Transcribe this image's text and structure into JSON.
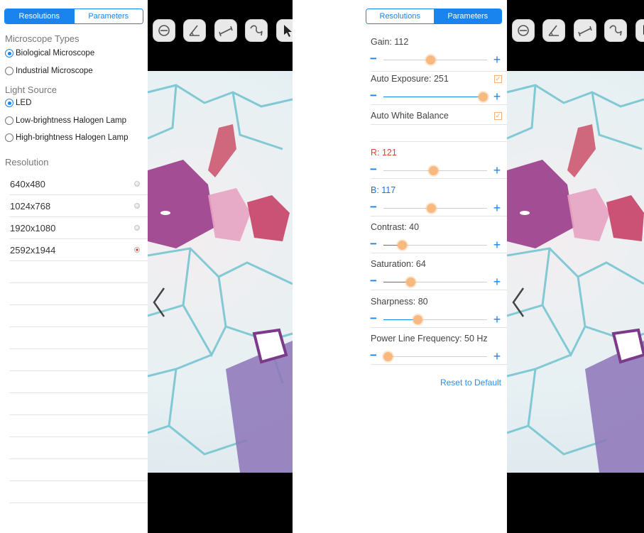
{
  "tabs": {
    "resolutions": "Resolutions",
    "parameters": "Parameters"
  },
  "left_panel": {
    "active_tab": "resolutions",
    "microscope_types": {
      "title": "Microscope Types",
      "options": [
        {
          "label": "Biological Microscope",
          "selected": true
        },
        {
          "label": "Industrial Microscope",
          "selected": false
        }
      ]
    },
    "light_source": {
      "title": "Light Source",
      "options": [
        {
          "label": "LED",
          "selected": true
        },
        {
          "label": "Low-brightness Halogen Lamp",
          "selected": false
        },
        {
          "label": "High-brightness Halogen Lamp",
          "selected": false
        }
      ]
    },
    "resolution": {
      "title": "Resolution",
      "items": [
        {
          "label": "640x480",
          "selected": false
        },
        {
          "label": "1024x768",
          "selected": false
        },
        {
          "label": "1920x1080",
          "selected": false
        },
        {
          "label": "2592x1944",
          "selected": true
        }
      ]
    }
  },
  "right_panel": {
    "active_tab": "parameters",
    "params": {
      "gain": {
        "label": "Gain: 112",
        "value_fraction": 0.45,
        "filled": false
      },
      "auto_exposure": {
        "label": "Auto Exposure: 251",
        "value_fraction": 0.96,
        "filled": true,
        "checked": true
      },
      "auto_white_balance": {
        "label": "Auto White Balance",
        "checked": true
      },
      "r": {
        "label": "R: 121",
        "value_fraction": 0.48,
        "filled": false,
        "color": "#e0403a"
      },
      "b": {
        "label": "B: 117",
        "value_fraction": 0.46,
        "filled": false,
        "color": "#1a6ee8"
      },
      "contrast": {
        "label": "Contrast: 40",
        "value_fraction": 0.18,
        "filled": true
      },
      "saturation": {
        "label": "Saturation: 64",
        "value_fraction": 0.26,
        "filled": true
      },
      "sharpness": {
        "label": "Sharpness: 80",
        "value_fraction": 0.33,
        "filled": true
      },
      "power_line_frequency": {
        "label": "Power Line Frequency: 50 Hz",
        "value_fraction": 0.04,
        "filled": true
      }
    },
    "reset_label": "Reset to Default"
  },
  "toolbar_icons": [
    "circle-tool-icon",
    "angle-tool-icon",
    "line-tool-icon",
    "freehand-tool-icon",
    "pointer-tool-icon"
  ],
  "colors": {
    "accent": "#1a84ee",
    "thumb": "#f7b980",
    "red_channel": "#e0403a",
    "blue_channel": "#1a6ee8"
  }
}
